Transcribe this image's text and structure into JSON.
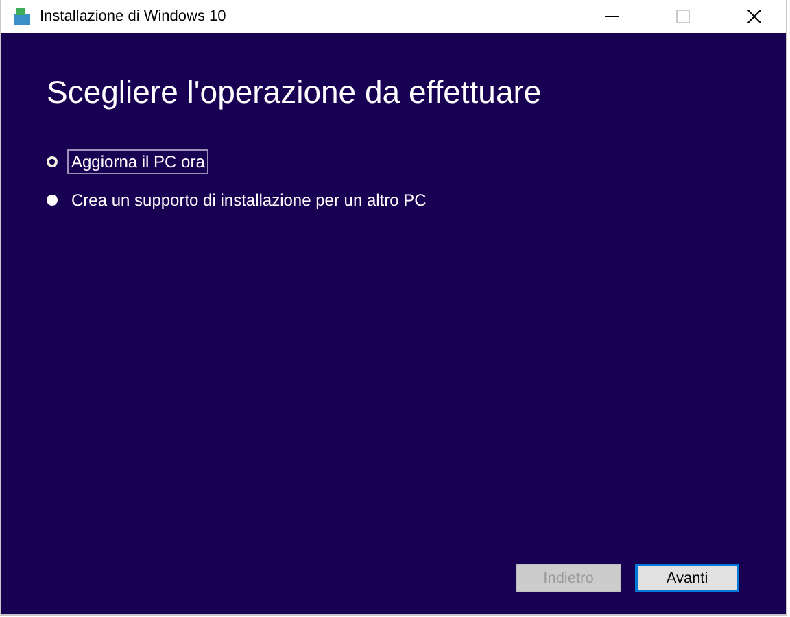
{
  "window": {
    "title": "Installazione di Windows 10"
  },
  "heading": "Scegliere l'operazione da effettuare",
  "options": [
    {
      "label": "Aggiorna il PC ora",
      "selected": true
    },
    {
      "label": "Crea un supporto di installazione per un altro PC",
      "selected": false
    }
  ],
  "buttons": [
    {
      "label": "Indietro",
      "disabled": true,
      "focused": false
    },
    {
      "label": "Avanti",
      "disabled": false,
      "focused": true
    }
  ]
}
